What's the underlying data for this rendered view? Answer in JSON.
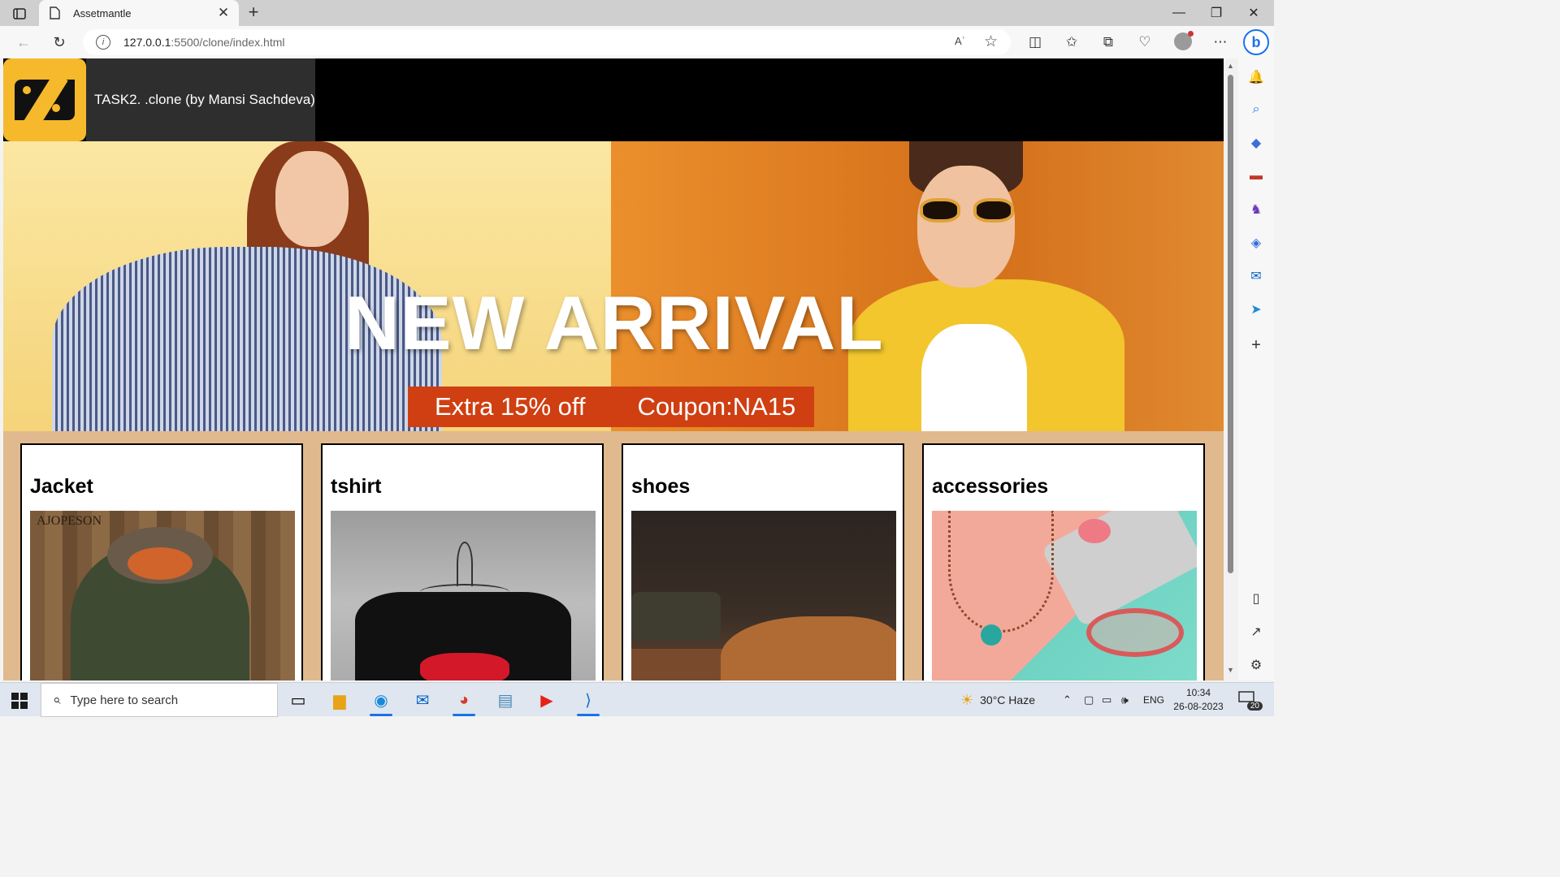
{
  "browser": {
    "tab_title": "Assetmantle",
    "url_host": "127.0.0.1",
    "url_path": ":5500/clone/index.html",
    "read_aloud_label": "Aʾ",
    "icons": [
      "sidebar-toggle-icon",
      "document-icon",
      "close-icon",
      "plus-icon",
      "back-icon",
      "refresh-icon",
      "info-icon",
      "read-aloud-icon",
      "star-icon",
      "split-screen-icon",
      "favorites-icon",
      "collections-icon",
      "performance-icon",
      "profile-icon",
      "more-icon",
      "bing-icon"
    ],
    "window_controls": [
      "—",
      "❐",
      "✕"
    ]
  },
  "site": {
    "brand_text": "TASK2. .clone (by Mansi Sachdeva)",
    "hero": {
      "headline": "NEW  ARRIVAL",
      "offer": "Extra 15% off",
      "coupon": "Coupon:NA15"
    },
    "categories": [
      {
        "title": "Jacket",
        "image_mark": "AJOPESON"
      },
      {
        "title": "tshirt"
      },
      {
        "title": "shoes"
      },
      {
        "title": "accessories"
      }
    ]
  },
  "sidebar": {
    "icons": [
      "bell-icon",
      "search-icon",
      "tag-icon",
      "toolbox-icon",
      "games-icon",
      "microsoft365-icon",
      "outlook-icon",
      "send-icon",
      "add-icon",
      "panel-icon",
      "external-link-icon",
      "settings-icon"
    ]
  },
  "taskbar": {
    "search_placeholder": "Type here to search",
    "apps": [
      "task-view-icon",
      "file-explorer-icon",
      "edge-icon",
      "mail-icon",
      "chrome-icon",
      "notepad-icon",
      "youtube-icon",
      "vscode-icon"
    ],
    "weather": "30°C  Haze",
    "language": "ENG",
    "time": "10:34",
    "date": "26-08-2023",
    "notification_count": "20"
  },
  "colors": {
    "page_bg": "#e0b98e",
    "header_bg": "#000000",
    "brand_block": "#2e2e2e",
    "logo_yellow": "#f5b92b",
    "coupon_red": "#cf3f12"
  }
}
